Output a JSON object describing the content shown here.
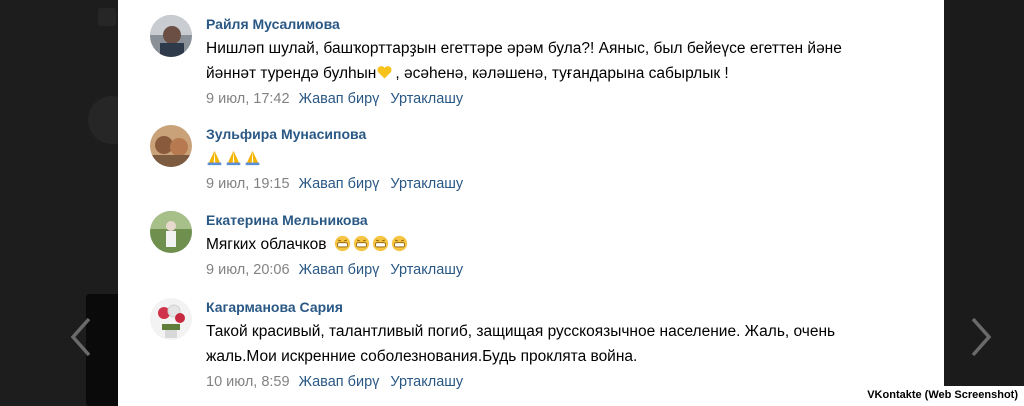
{
  "comments": [
    {
      "author": "Райля Мусалимова",
      "text_line1": "Нишләп шулай, башҡорттарҙын егеттәре әрәм була?! Аяныс, был бейеүсе егеттен йәне",
      "text_line2a": "йәннәт турендә булһын",
      "text_line2b": ", әсәһенә, кәләшенә, туғандарына сабырлык !",
      "time": "9 июл, 17:42",
      "reply": "Жавап бирү",
      "share": "Уртаклашу",
      "emoji": "yellow-heart"
    },
    {
      "author": "Зульфира Мунасипова",
      "text": "",
      "time": "9 июл, 19:15",
      "reply": "Жавап бирү",
      "share": "Уртаклашу",
      "emoji": "folded-hands",
      "emoji_count": 3
    },
    {
      "author": "Екатерина Мельникова",
      "text": "Мягких облачков",
      "time": "9 июл, 20:06",
      "reply": "Жавап бирү",
      "share": "Уртаклашу",
      "emoji": "grinning-face",
      "emoji_count": 4
    },
    {
      "author": "Кагарманова Сария",
      "text_line1": "Такой красивый, талантливый погиб, защищая русскоязычное население. Жаль, очень",
      "text_line2": "жаль.Мои искренние соболезнования.Будь проклята война.",
      "time": "10 июл, 8:59",
      "reply": "Жавап бирү",
      "share": "Уртаклашу"
    }
  ],
  "credit": "VKontakte (Web Screenshot)",
  "colors": {
    "author": "#2a5885",
    "meta": "#828282",
    "panel_bg": "#ffffff",
    "backdrop": "#1b1b1b"
  }
}
